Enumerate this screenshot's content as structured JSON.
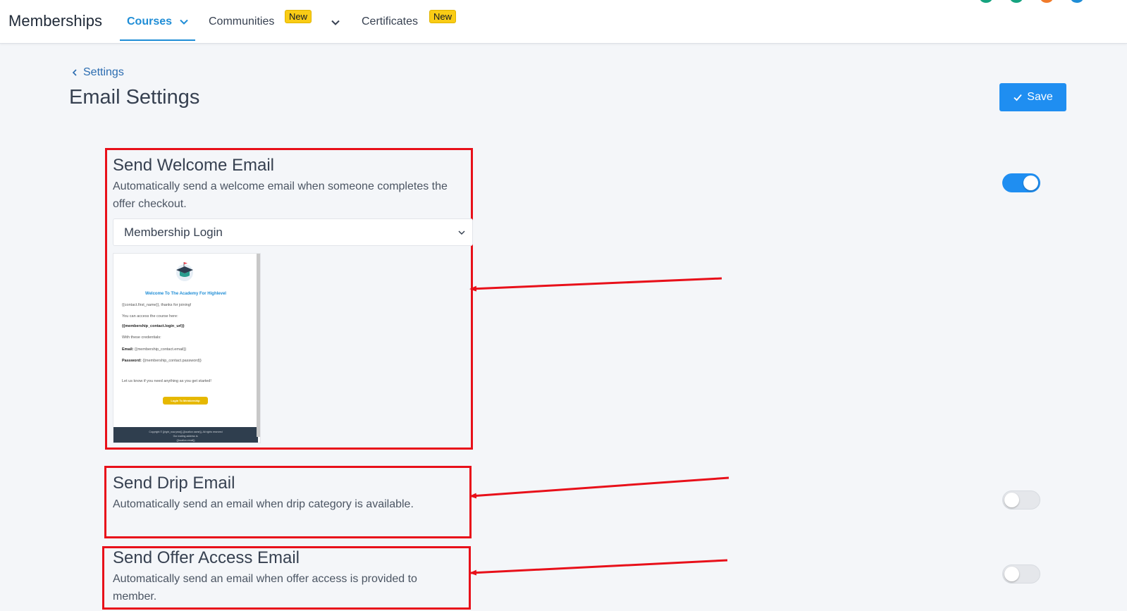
{
  "topnav": {
    "brand": "Memberships",
    "tabs": [
      {
        "label": "Courses",
        "active": true
      },
      {
        "label": "Communities",
        "badge": "New"
      },
      {
        "label": "Certificates",
        "badge": "New"
      }
    ]
  },
  "breadcrumb": {
    "label": "Settings"
  },
  "page": {
    "title": "Email Settings"
  },
  "toolbar": {
    "save_label": "Save"
  },
  "sections": {
    "welcome": {
      "title": "Send Welcome Email",
      "description": "Automatically send a welcome email when someone completes the offer checkout.",
      "enabled": true,
      "template_selected": "Membership Login"
    },
    "drip": {
      "title": "Send Drip Email",
      "description": "Automatically send an email when drip category is available.",
      "enabled": false
    },
    "offer": {
      "title": "Send Offer Access Email",
      "description": "Automatically send an email when offer access is provided to member.",
      "enabled": false
    }
  },
  "preview": {
    "heading": "Welcome To The Academy For Highlevel",
    "greeting": "{{contact.first_name}}, thanks for joining!",
    "access_line": "You can access the course here:",
    "login_url": "{{membership_contact.login_url}}",
    "credentials_line": "With these credentials:",
    "email_label": "Email:",
    "email_value": "{{membership_contact.email}}",
    "password_label": "Password:",
    "password_value": "{{membership_contact.password}}",
    "closing": "Let us know if you need anything as you get started!",
    "button": "Login To Membership",
    "footer_line1": "Copyright © {{right_now.year}} {{location.name}}, All rights reserved",
    "footer_line2": "Our mailing address is:",
    "footer_line3": "{{location.email}}"
  },
  "colors": {
    "accent": "#1f8ef1",
    "annotation_red": "#e8101a",
    "badge_yellow": "#facc15"
  }
}
